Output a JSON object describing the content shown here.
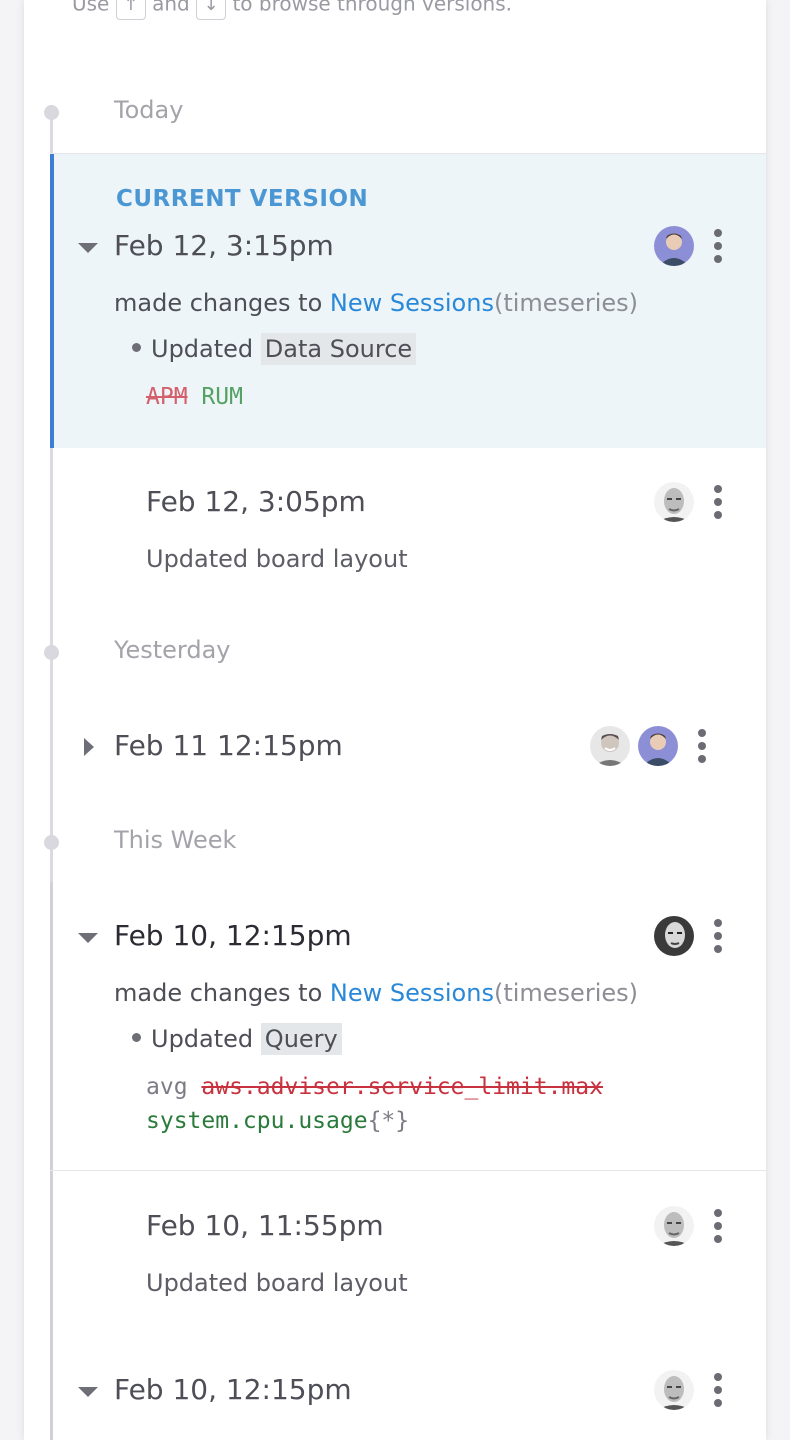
{
  "hint": {
    "use": "Use",
    "up_key": "↑",
    "and": "and",
    "down_key": "↓",
    "suffix": "to browse through versions."
  },
  "groups": {
    "today": "Today",
    "yesterday": "Yesterday",
    "this_week": "This Week"
  },
  "v1": {
    "tag": "CURRENT VERSION",
    "date": "Feb 12, 3:15pm",
    "made_changes": "made changes to",
    "widget": "New Sessions",
    "widget_type": "(timeseries)",
    "updated": "Updated",
    "field": "Data Source",
    "old": "APM",
    "new": "RUM"
  },
  "v2": {
    "date": "Feb 12, 3:05pm",
    "summary": "Updated board layout"
  },
  "v3": {
    "date": "Feb 11 12:15pm"
  },
  "v4": {
    "date": "Feb 10, 12:15pm",
    "made_changes": "made changes to",
    "widget": "New Sessions",
    "widget_type": "(timeseries)",
    "updated": "Updated",
    "field": "Query",
    "agg": "avg",
    "old_metric": "aws.adviser.service_limit.max",
    "new_metric": "system.cpu.usage",
    "scope": "{*}"
  },
  "v5": {
    "date": "Feb 10, 11:55pm",
    "summary": "Updated board layout"
  },
  "v6": {
    "date": "Feb 10, 12:15pm"
  },
  "colors": {
    "accent": "#3d7dd6",
    "link": "#2a88d8",
    "removed": "#c8313e",
    "added": "#2a7a3b",
    "current_bg": "#eef5f9"
  },
  "icons": [
    "caret-down-icon",
    "caret-right-icon",
    "kebab-menu-icon",
    "user-avatar",
    "up-arrow-key-icon",
    "down-arrow-key-icon"
  ]
}
